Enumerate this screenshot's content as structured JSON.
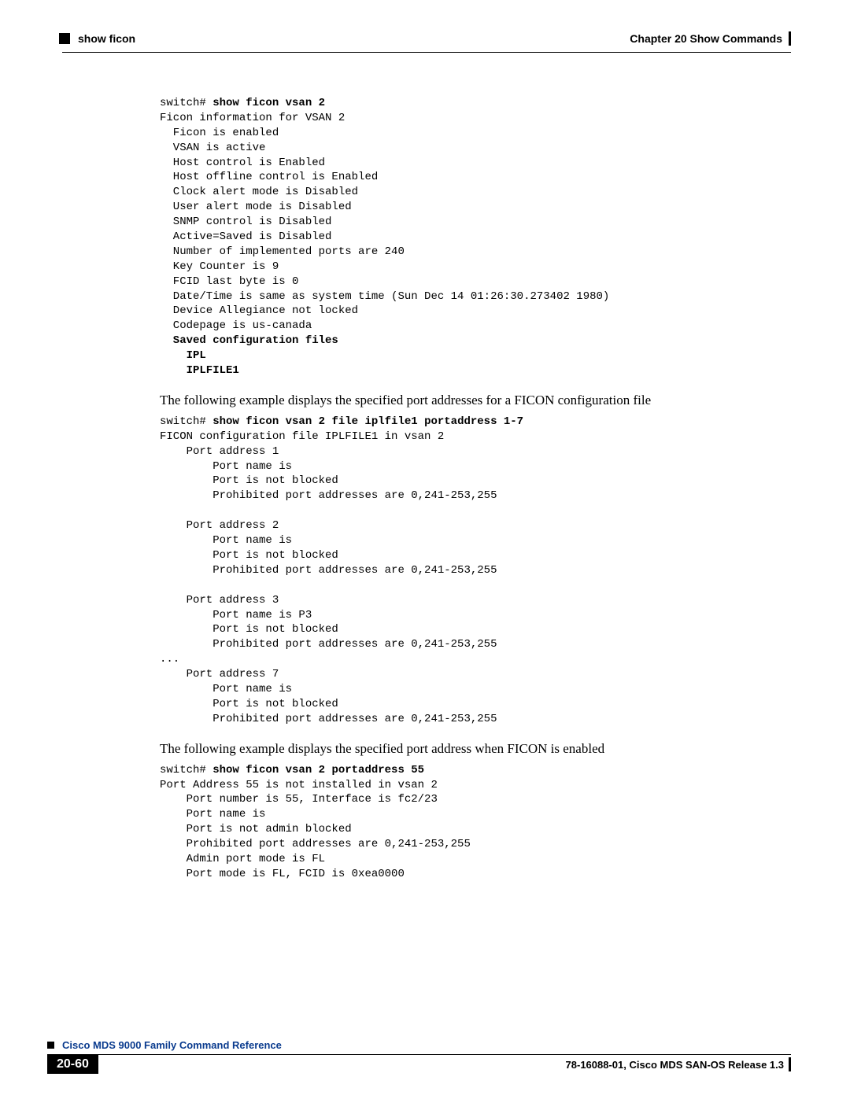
{
  "header": {
    "section": "show ficon",
    "chapter": "Chapter 20    Show Commands"
  },
  "block1": {
    "prompt": "switch# ",
    "cmd": "show ficon vsan 2",
    "lines": "Ficon information for VSAN 2\n  Ficon is enabled\n  VSAN is active\n  Host control is Enabled\n  Host offline control is Enabled\n  Clock alert mode is Disabled\n  User alert mode is Disabled\n  SNMP control is Disabled\n  Active=Saved is Disabled\n  Number of implemented ports are 240\n  Key Counter is 9\n  FCID last byte is 0\n  Date/Time is same as system time (Sun Dec 14 01:26:30.273402 1980)\n  Device Allegiance not locked\n  Codepage is us-canada",
    "saved_header": "  Saved configuration files",
    "saved_items": "    IPL\n    IPLFILE1"
  },
  "para1": "The following example displays the specified port addresses for a FICON configuration file",
  "block2": {
    "prompt": "switch# ",
    "cmd": "show ficon vsan 2 file iplfile1 portaddress 1-7",
    "lines": "FICON configuration file IPLFILE1 in vsan 2\n    Port address 1\n        Port name is\n        Port is not blocked\n        Prohibited port addresses are 0,241-253,255\n\n    Port address 2\n        Port name is\n        Port is not blocked\n        Prohibited port addresses are 0,241-253,255\n\n    Port address 3\n        Port name is P3\n        Port is not blocked\n        Prohibited port addresses are 0,241-253,255\n...\n    Port address 7\n        Port name is\n        Port is not blocked\n        Prohibited port addresses are 0,241-253,255"
  },
  "para2": "The following example displays the specified port address when FICON is enabled",
  "block3": {
    "prompt": "switch# ",
    "cmd": "show ficon vsan 2 portaddress 55",
    "lines": "Port Address 55 is not installed in vsan 2\n    Port number is 55, Interface is fc2/23\n    Port name is\n    Port is not admin blocked\n    Prohibited port addresses are 0,241-253,255\n    Admin port mode is FL\n    Port mode is FL, FCID is 0xea0000"
  },
  "footer": {
    "title": "Cisco MDS 9000 Family Command Reference",
    "page": "20-60",
    "release": "78-16088-01, Cisco MDS SAN-OS Release 1.3"
  }
}
